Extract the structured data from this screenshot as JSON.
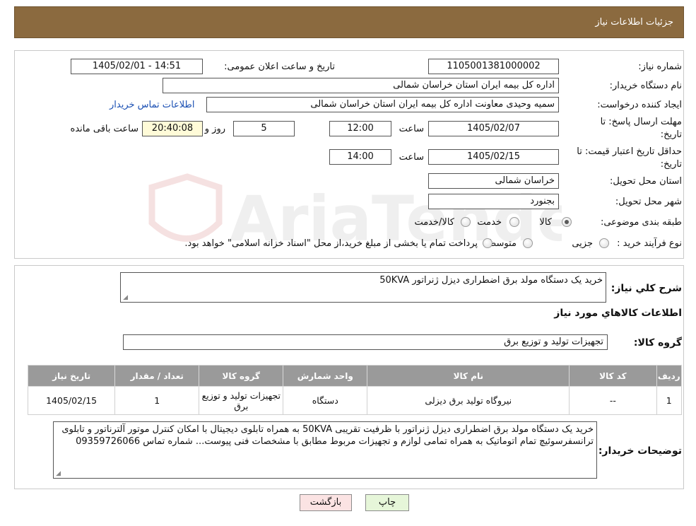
{
  "header": {
    "title": "جزئیات اطلاعات نیاز"
  },
  "info": {
    "need_number_label": "شماره نیاز:",
    "need_number": "1105001381000002",
    "announce_label": "تاریخ و ساعت اعلان عمومی:",
    "announce_value": "1405/02/01 - 14:51",
    "buyer_org_label": "نام دستگاه خریدار:",
    "buyer_org": "اداره کل بیمه ایران استان خراسان شمالی",
    "creator_label": "ایجاد کننده درخواست:",
    "creator": "سمیه وحیدی معاونت اداره کل بیمه ایران استان خراسان شمالی",
    "contact_link": "اطلاعات تماس خریدار",
    "deadline_label_1": "مهلت ارسال پاسخ: تا",
    "deadline_label_2": "تاریخ:",
    "deadline_date": "1405/02/07",
    "time_label": "ساعت",
    "deadline_time": "12:00",
    "days_count": "5",
    "days_label": "روز و",
    "remaining_time": "20:40:08",
    "remaining_label": "ساعت باقی مانده",
    "validity_label_1": "حداقل تاریخ اعتبار قیمت: تا",
    "validity_label_2": "تاریخ:",
    "validity_date": "1405/02/15",
    "validity_time_label": "ساعت",
    "validity_time": "14:00",
    "province_label": "استان محل تحویل:",
    "province": "خراسان شمالی",
    "city_label": "شهر محل تحویل:",
    "city": "بجنورد",
    "category_label": "طبقه بندی موضوعی:",
    "category_options": [
      "کالا",
      "خدمت",
      "کالا/خدمت"
    ],
    "category_selected": 0,
    "process_label": "نوع فرآیند خرید :",
    "process_options": [
      "جزیی",
      "متوسط"
    ],
    "process_note": "پرداخت تمام یا بخشی از مبلغ خرید،از محل \"اسناد خزانه اسلامی\" خواهد بود."
  },
  "details": {
    "summary_label": "شرح کلي نياز:",
    "summary": "خرید یک دستگاه مولد برق اضطراری دیزل ژنراتور 50KVA",
    "goods_section_title": "اطلاعات کالاهاي مورد نياز",
    "goods_group_label": "گروه کالا:",
    "goods_group": "تجهیزات تولید و توزیع برق",
    "table": {
      "headers": [
        "رديف",
        "کد کالا",
        "نام کالا",
        "واحد شمارش",
        "گروه کالا",
        "تعداد / مقدار",
        "تاريخ نياز"
      ],
      "rows": [
        [
          "1",
          "--",
          "نیروگاه تولید برق دیزلی",
          "دستگاه",
          "تجهیزات تولید و توزیع برق",
          "1",
          "1405/02/15"
        ]
      ]
    },
    "buyer_notes_label": "توضیحات خریدار:",
    "buyer_notes": "خرید یک دستگاه مولد برق اضطراری دیزل ژنراتور با ظرفیت تقریبی 50KVA به همراه تابلوی دیجیتال با امکان کنترل موتور آلترناتور و تابلوی ترانسفرسوئیچ تمام اتوماتیک به همراه تمامی لوازم و تجهیزات مربوط مطابق با مشخصات فنی پیوست... شماره تماس 09359726066"
  },
  "buttons": {
    "back": "بازگشت",
    "print": "چاپ"
  },
  "watermark_text": "AriaTender.neT"
}
